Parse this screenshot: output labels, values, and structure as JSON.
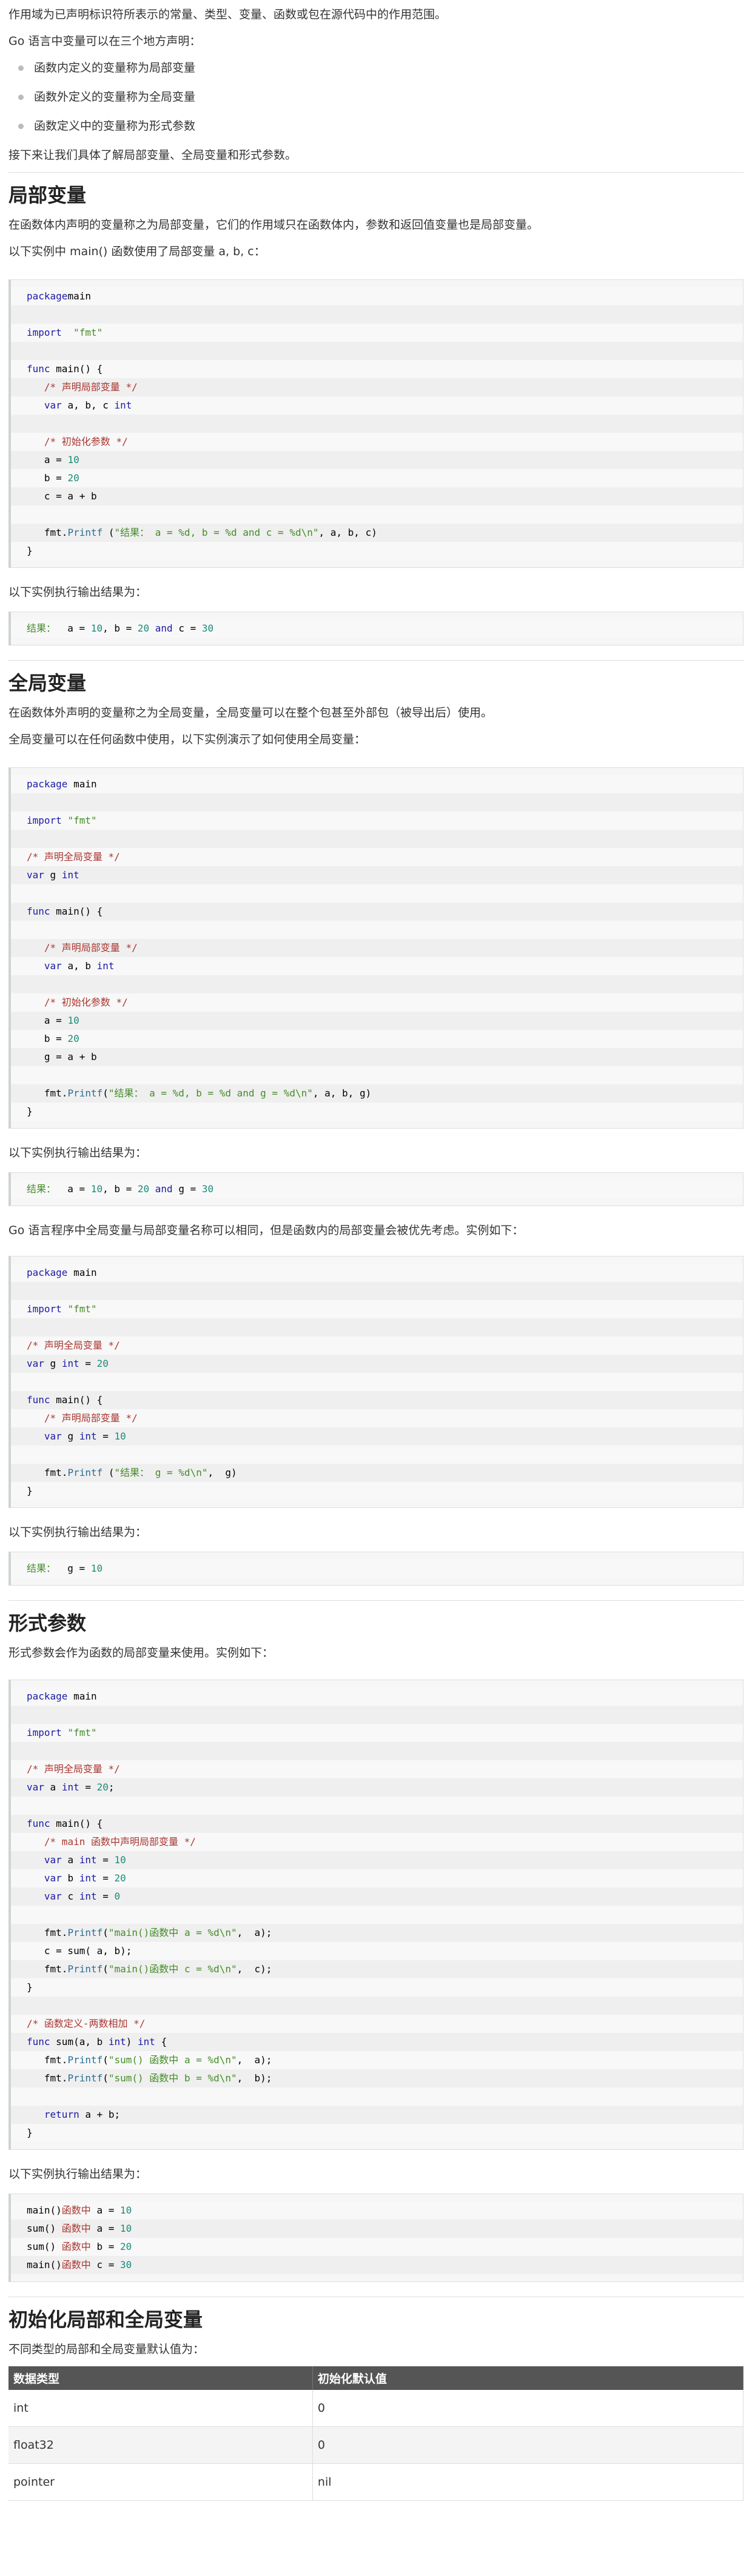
{
  "intro": {
    "p1": "作用域为已声明标识符所表示的常量、类型、变量、函数或包在源代码中的作用范围。",
    "p2": "Go 语言中变量可以在三个地方声明：",
    "bullets": [
      "函数内定义的变量称为局部变量",
      "函数外定义的变量称为全局变量",
      "函数定义中的变量称为形式参数"
    ],
    "p3": "接下来让我们具体了解局部变量、全局变量和形式参数。"
  },
  "local": {
    "heading": "局部变量",
    "p1": "在函数体内声明的变量称之为局部变量，它们的作用域只在函数体内，参数和返回值变量也是局部变量。",
    "p2": "以下实例中 main() 函数使用了局部变量 a, b, c：",
    "code": [
      [
        [
          "kw",
          "package"
        ],
        [
          "",
          "main"
        ]
      ],
      [],
      [
        [
          "kw",
          "import"
        ],
        [
          "",
          "  "
        ],
        [
          "str",
          "\"fmt\""
        ]
      ],
      [],
      [
        [
          "kw",
          "func"
        ],
        [
          "",
          " main() {"
        ]
      ],
      [
        [
          "",
          "   "
        ],
        [
          "cm",
          "/* 声明局部变量 */"
        ]
      ],
      [
        [
          "",
          "   "
        ],
        [
          "kw",
          "var"
        ],
        [
          "",
          " a, b, c "
        ],
        [
          "kw",
          "int"
        ]
      ],
      [],
      [
        [
          "",
          "   "
        ],
        [
          "cm",
          "/* 初始化参数 */"
        ]
      ],
      [
        [
          "",
          "   a = "
        ],
        [
          "num",
          "10"
        ]
      ],
      [
        [
          "",
          "   b = "
        ],
        [
          "num",
          "20"
        ]
      ],
      [
        [
          "",
          "   c = a + b"
        ]
      ],
      [],
      [
        [
          "",
          "   fmt."
        ],
        [
          "fn",
          "Printf"
        ],
        [
          "",
          " ("
        ],
        [
          "str",
          "\"结果： a = %d, b = %d and c = %d\\n\""
        ],
        [
          "",
          ", a, b, c)"
        ]
      ],
      [
        [
          "",
          "}"
        ]
      ]
    ],
    "output_label": "以下实例执行输出结果为：",
    "output": [
      [
        [
          "str",
          "结果： "
        ],
        [
          "",
          " a = "
        ],
        [
          "num",
          "10"
        ],
        [
          "",
          ", b = "
        ],
        [
          "num",
          "20"
        ],
        [
          "",
          " "
        ],
        [
          "kw",
          "and"
        ],
        [
          "",
          " c = "
        ],
        [
          "num",
          "30"
        ]
      ]
    ]
  },
  "global": {
    "heading": "全局变量",
    "p1": "在函数体外声明的变量称之为全局变量，全局变量可以在整个包甚至外部包（被导出后）使用。",
    "p2": "全局变量可以在任何函数中使用，以下实例演示了如何使用全局变量：",
    "code": [
      [
        [
          "kw",
          "package"
        ],
        [
          "",
          " main"
        ]
      ],
      [],
      [
        [
          "kw",
          "import"
        ],
        [
          "",
          " "
        ],
        [
          "str",
          "\"fmt\""
        ]
      ],
      [],
      [
        [
          "cm",
          "/* 声明全局变量 */"
        ]
      ],
      [
        [
          "kw",
          "var"
        ],
        [
          "",
          " g "
        ],
        [
          "kw",
          "int"
        ]
      ],
      [],
      [
        [
          "kw",
          "func"
        ],
        [
          "",
          " main() {"
        ]
      ],
      [],
      [
        [
          "",
          "   "
        ],
        [
          "cm",
          "/* 声明局部变量 */"
        ]
      ],
      [
        [
          "",
          "   "
        ],
        [
          "kw",
          "var"
        ],
        [
          "",
          " a, b "
        ],
        [
          "kw",
          "int"
        ]
      ],
      [],
      [
        [
          "",
          "   "
        ],
        [
          "cm",
          "/* 初始化参数 */"
        ]
      ],
      [
        [
          "",
          "   a = "
        ],
        [
          "num",
          "10"
        ]
      ],
      [
        [
          "",
          "   b = "
        ],
        [
          "num",
          "20"
        ]
      ],
      [
        [
          "",
          "   g = a + b"
        ]
      ],
      [],
      [
        [
          "",
          "   fmt."
        ],
        [
          "fn",
          "Printf"
        ],
        [
          "",
          "("
        ],
        [
          "str",
          "\"结果： a = %d, b = %d and g = %d\\n\""
        ],
        [
          "",
          ", a, b, g)"
        ]
      ],
      [
        [
          "",
          "}"
        ]
      ]
    ],
    "output_label": "以下实例执行输出结果为：",
    "output": [
      [
        [
          "str",
          "结果： "
        ],
        [
          "",
          " a = "
        ],
        [
          "num",
          "10"
        ],
        [
          "",
          ", b = "
        ],
        [
          "num",
          "20"
        ],
        [
          "",
          " "
        ],
        [
          "kw",
          "and"
        ],
        [
          "",
          " g = "
        ],
        [
          "num",
          "30"
        ]
      ]
    ],
    "p3": "Go 语言程序中全局变量与局部变量名称可以相同，但是函数内的局部变量会被优先考虑。实例如下：",
    "code2": [
      [
        [
          "kw",
          "package"
        ],
        [
          "",
          " main"
        ]
      ],
      [],
      [
        [
          "kw",
          "import"
        ],
        [
          "",
          " "
        ],
        [
          "str",
          "\"fmt\""
        ]
      ],
      [],
      [
        [
          "cm",
          "/* 声明全局变量 */"
        ]
      ],
      [
        [
          "kw",
          "var"
        ],
        [
          "",
          " g "
        ],
        [
          "kw",
          "int"
        ],
        [
          "",
          " = "
        ],
        [
          "num",
          "20"
        ]
      ],
      [],
      [
        [
          "kw",
          "func"
        ],
        [
          "",
          " main() {"
        ]
      ],
      [
        [
          "",
          "   "
        ],
        [
          "cm",
          "/* 声明局部变量 */"
        ]
      ],
      [
        [
          "",
          "   "
        ],
        [
          "kw",
          "var"
        ],
        [
          "",
          " g "
        ],
        [
          "kw",
          "int"
        ],
        [
          "",
          " = "
        ],
        [
          "num",
          "10"
        ]
      ],
      [],
      [
        [
          "",
          "   fmt."
        ],
        [
          "fn",
          "Printf"
        ],
        [
          "",
          " ("
        ],
        [
          "str",
          "\"结果： g = %d\\n\""
        ],
        [
          "",
          ",  g)"
        ]
      ],
      [
        [
          "",
          "}"
        ]
      ]
    ],
    "output_label2": "以下实例执行输出结果为：",
    "output2": [
      [
        [
          "str",
          "结果： "
        ],
        [
          "",
          " g = "
        ],
        [
          "num",
          "10"
        ]
      ]
    ]
  },
  "params": {
    "heading": "形式参数",
    "p1": "形式参数会作为函数的局部变量来使用。实例如下：",
    "code": [
      [
        [
          "kw",
          "package"
        ],
        [
          "",
          " main"
        ]
      ],
      [],
      [
        [
          "kw",
          "import"
        ],
        [
          "",
          " "
        ],
        [
          "str",
          "\"fmt\""
        ]
      ],
      [],
      [
        [
          "cm",
          "/* 声明全局变量 */"
        ]
      ],
      [
        [
          "kw",
          "var"
        ],
        [
          "",
          " a "
        ],
        [
          "kw",
          "int"
        ],
        [
          "",
          " = "
        ],
        [
          "num",
          "20"
        ],
        [
          "",
          ";"
        ]
      ],
      [],
      [
        [
          "kw",
          "func"
        ],
        [
          "",
          " main() {"
        ]
      ],
      [
        [
          "",
          "   "
        ],
        [
          "cm",
          "/* main 函数中声明局部变量 */"
        ]
      ],
      [
        [
          "",
          "   "
        ],
        [
          "kw",
          "var"
        ],
        [
          "",
          " a "
        ],
        [
          "kw",
          "int"
        ],
        [
          "",
          " = "
        ],
        [
          "num",
          "10"
        ]
      ],
      [
        [
          "",
          "   "
        ],
        [
          "kw",
          "var"
        ],
        [
          "",
          " b "
        ],
        [
          "kw",
          "int"
        ],
        [
          "",
          " = "
        ],
        [
          "num",
          "20"
        ]
      ],
      [
        [
          "",
          "   "
        ],
        [
          "kw",
          "var"
        ],
        [
          "",
          " c "
        ],
        [
          "kw",
          "int"
        ],
        [
          "",
          " = "
        ],
        [
          "num",
          "0"
        ]
      ],
      [],
      [
        [
          "",
          "   fmt."
        ],
        [
          "fn",
          "Printf"
        ],
        [
          "",
          "("
        ],
        [
          "str",
          "\"main()函数中 a = %d\\n\""
        ],
        [
          "",
          ",  a);"
        ]
      ],
      [
        [
          "",
          "   c = sum( a, b);"
        ]
      ],
      [
        [
          "",
          "   fmt."
        ],
        [
          "fn",
          "Printf"
        ],
        [
          "",
          "("
        ],
        [
          "str",
          "\"main()函数中 c = %d\\n\""
        ],
        [
          "",
          ",  c);"
        ]
      ],
      [
        [
          "",
          "}"
        ]
      ],
      [],
      [
        [
          "cm",
          "/* 函数定义-两数相加 */"
        ]
      ],
      [
        [
          "kw",
          "func"
        ],
        [
          "",
          " sum(a, b "
        ],
        [
          "kw",
          "int"
        ],
        [
          "",
          ") "
        ],
        [
          "kw",
          "int"
        ],
        [
          "",
          " {"
        ]
      ],
      [
        [
          "",
          "   fmt."
        ],
        [
          "fn",
          "Printf"
        ],
        [
          "",
          "("
        ],
        [
          "str",
          "\"sum() 函数中 a = %d\\n\""
        ],
        [
          "",
          ",  a);"
        ]
      ],
      [
        [
          "",
          "   fmt."
        ],
        [
          "fn",
          "Printf"
        ],
        [
          "",
          "("
        ],
        [
          "str",
          "\"sum() 函数中 b = %d\\n\""
        ],
        [
          "",
          ",  b);"
        ]
      ],
      [],
      [
        [
          "",
          "   "
        ],
        [
          "kw",
          "return"
        ],
        [
          "",
          " a + b;"
        ]
      ],
      [
        [
          "",
          "}"
        ]
      ]
    ],
    "output_label": "以下实例执行输出结果为：",
    "output": [
      [
        [
          "",
          "main()"
        ],
        [
          "cm",
          "函数中"
        ],
        [
          "",
          " a = "
        ],
        [
          "num",
          "10"
        ]
      ],
      [
        [
          "",
          "sum() "
        ],
        [
          "cm",
          "函数中"
        ],
        [
          "",
          " a = "
        ],
        [
          "num",
          "10"
        ]
      ],
      [
        [
          "",
          "sum() "
        ],
        [
          "cm",
          "函数中"
        ],
        [
          "",
          " b = "
        ],
        [
          "num",
          "20"
        ]
      ],
      [
        [
          "",
          "main()"
        ],
        [
          "cm",
          "函数中"
        ],
        [
          "",
          " c = "
        ],
        [
          "num",
          "30"
        ]
      ]
    ]
  },
  "init": {
    "heading": "初始化局部和全局变量",
    "p1": "不同类型的局部和全局变量默认值为：",
    "table": {
      "headers": [
        "数据类型",
        "初始化默认值"
      ],
      "rows": [
        [
          "int",
          "0"
        ],
        [
          "float32",
          "0"
        ],
        [
          "pointer",
          "nil"
        ]
      ]
    }
  }
}
